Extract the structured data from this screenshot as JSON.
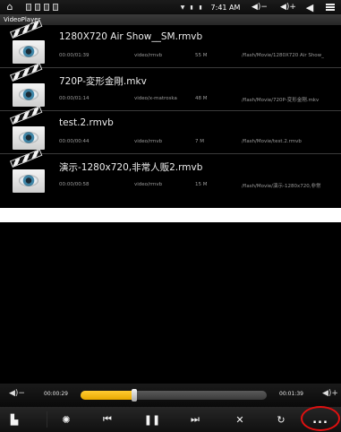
{
  "status_bar": {
    "time": "7:41 AM",
    "vol_down_text": "◀)−",
    "vol_up_text": "◀)+"
  },
  "title_bar": {
    "title": "VideoPlayer"
  },
  "files": [
    {
      "name": "1280X720 Air Show__SM.rmvb",
      "duration": "00:00/01:39",
      "mime": "video/rmvb",
      "size": "55 M",
      "path": "/flash/Movie/1280X720 Air Show_"
    },
    {
      "name": "720P-変形金剛.mkv",
      "duration": "00:00/01:14",
      "mime": "video/x-matroska",
      "size": "48 M",
      "path": "/flash/Movie/720P-変形金剛.mkv"
    },
    {
      "name": "test.2.rmvb",
      "duration": "00:00/00:44",
      "mime": "video/rmvb",
      "size": "7 M",
      "path": "/flash/Movie/test.2.rmvb"
    },
    {
      "name": "演示-1280x720,非常人贩2.rmvb",
      "duration": "00:00/00:58",
      "mime": "video/rmvb",
      "size": "15 M",
      "path": "/flash/Movie/演示-1280x720,非常"
    }
  ],
  "player": {
    "current_time": "00:00:29",
    "total_time": "00:01:39",
    "progress": 0.29,
    "more_label": "..."
  },
  "icons": {
    "home": "home-icon",
    "notifications": "notification-icon",
    "wifi": "wifi-icon",
    "battery": "battery-icon",
    "volume_down": "volume-down-icon",
    "volume_up": "volume-up-icon",
    "back": "back-arrow-icon",
    "menu": "menu-icon",
    "thumbnail": "clapperboard-eye-icon",
    "playlist": "playlist-icon",
    "brightness": "brightness-icon",
    "previous": "previous-icon",
    "pause": "pause-icon",
    "next": "next-icon",
    "shuffle": "shuffle-icon",
    "repeat": "repeat-icon",
    "more": "more-icon"
  },
  "colors": {
    "progress_fill": "#f0b400",
    "highlight_circle": "#e01010"
  }
}
